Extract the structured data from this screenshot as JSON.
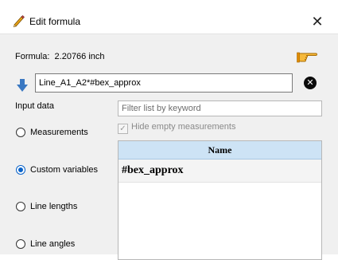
{
  "window": {
    "title": "Edit formula",
    "close_glyph": "✕",
    "icon": "pencil-icon"
  },
  "formula": {
    "label": "Formula:",
    "value": "2.20766 inch",
    "expression": "Line_A1_A2*#bex_approx",
    "hint_icon": "pointing-hand-icon",
    "insert_icon": "arrow-down-icon",
    "clear_glyph": "✕"
  },
  "input_data": {
    "label": "Input data",
    "filter_placeholder": "Filter list by keyword",
    "hide_empty_label": "Hide empty measurements",
    "hide_empty_checked": true,
    "options": [
      {
        "label": "Measurements",
        "selected": false
      },
      {
        "label": "Custom variables",
        "selected": true
      },
      {
        "label": "Line lengths",
        "selected": false
      },
      {
        "label": "Line angles",
        "selected": false
      }
    ]
  },
  "table": {
    "columns": [
      "Name"
    ],
    "rows": [
      {
        "name": "#bex_approx"
      }
    ]
  },
  "colors": {
    "accent": "#0a63c9",
    "header_bg": "#cde3f5",
    "panel_bg": "#f0f0f0"
  }
}
